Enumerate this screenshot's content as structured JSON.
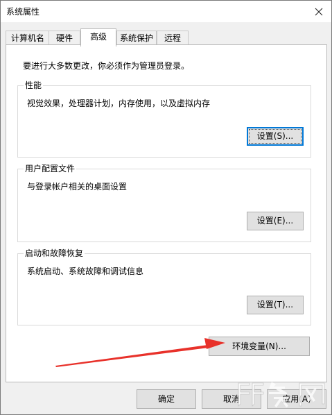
{
  "window": {
    "title": "系统属性",
    "close_icon": "close-icon"
  },
  "tabs": [
    {
      "label": "计算机名",
      "active": false
    },
    {
      "label": "硬件",
      "active": false
    },
    {
      "label": "高级",
      "active": true
    },
    {
      "label": "系统保护",
      "active": false
    },
    {
      "label": "远程",
      "active": false
    }
  ],
  "advanced": {
    "admin_note": "要进行大多数更改，你必须作为管理员登录。",
    "performance": {
      "title": "性能",
      "description": "视觉效果，处理器计划，内存使用，以及虚拟内存",
      "button": "设置(S)..."
    },
    "user_profiles": {
      "title": "用户配置文件",
      "description": "与登录帐户相关的桌面设置",
      "button": "设置(E)..."
    },
    "startup_recovery": {
      "title": "启动和故障恢复",
      "description": "系统启动、系统故障和调试信息",
      "button": "设置(T)..."
    },
    "env_vars_button": "环境变量(N)..."
  },
  "footer": {
    "ok_label": "确定",
    "cancel_label": "取消",
    "apply_label": "应用(A)"
  },
  "annotation": {
    "arrow_color": "#e8312a",
    "icon": "red-arrow-icon"
  },
  "watermark": {
    "text": "羽兔网"
  }
}
